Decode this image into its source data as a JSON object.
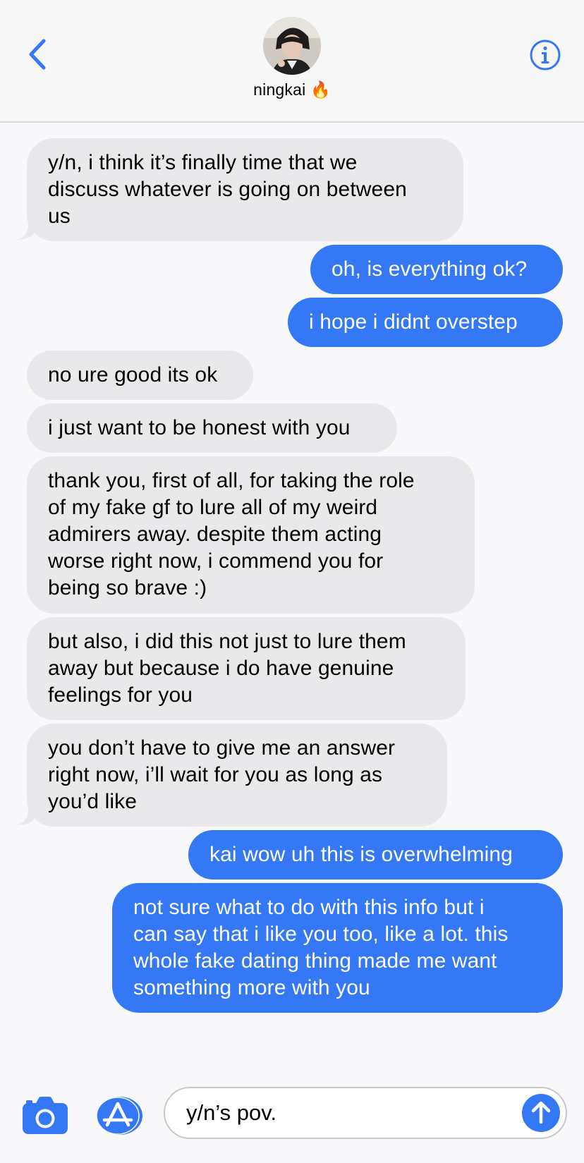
{
  "header": {
    "contact_name": "ningkai 🔥",
    "back_icon": "chevron-left-icon",
    "info_icon": "info-icon"
  },
  "colors": {
    "accent": "#3478f6",
    "incoming_bubble": "#e9e9eb",
    "background": "#f8f8fa"
  },
  "messages": [
    {
      "from": "them",
      "text": "y/n, i think it’s finally time that we\ndiscuss whatever is going on between\nus"
    },
    {
      "from": "me",
      "text": "oh, is everything ok?"
    },
    {
      "from": "me",
      "text": "i hope i didnt overstep"
    },
    {
      "from": "them",
      "text": "no ure good its ok"
    },
    {
      "from": "them",
      "text": "i just want to be honest with you"
    },
    {
      "from": "them",
      "text": "thank you, first of all, for taking the role\nof my fake gf to lure all of my weird\nadmirers away. despite them acting\nworse right now, i commend you for\nbeing so brave :)"
    },
    {
      "from": "them",
      "text": "but also, i did this not just to lure them\naway but because i do have genuine\nfeelings for you"
    },
    {
      "from": "them",
      "text": "you don’t have to give me an answer\nright now, i’ll wait for you as long as\nyou’d like"
    },
    {
      "from": "me",
      "text": "kai wow uh this is overwhelming"
    },
    {
      "from": "me",
      "text": "not sure what to do with this info but i\ncan say that i like you too, like a lot. this\nwhole fake dating thing made me want\nsomething more with you"
    }
  ],
  "input_bar": {
    "message_text": "y/n’s pov.",
    "camera_icon": "camera-icon",
    "apps_icon": "app-store-icon",
    "send_icon": "arrow-up-icon"
  }
}
